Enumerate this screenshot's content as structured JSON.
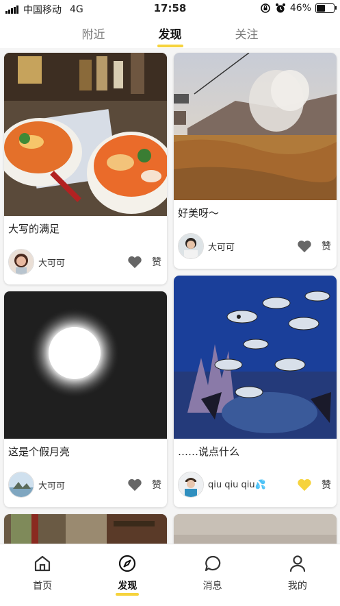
{
  "status_bar": {
    "carrier": "中国移动",
    "network": "4G",
    "time": "17:58",
    "battery": "46%",
    "battery_level": 0.46
  },
  "top_tabs": [
    {
      "label": "附近",
      "active": false
    },
    {
      "label": "发现",
      "active": true
    },
    {
      "label": "关注",
      "active": false
    }
  ],
  "accent_color": "#f6d33d",
  "feed": {
    "left": [
      {
        "title": "大写的满足",
        "author": "大可可",
        "like_label": "赞",
        "liked": false,
        "image": "ramen-photo"
      },
      {
        "title": "这是个假月亮",
        "author": "大可可",
        "like_label": "赞",
        "liked": false,
        "image": "moon-photo"
      },
      {
        "image": "street-photo"
      }
    ],
    "right": [
      {
        "title": "好美呀～",
        "author": "大可可",
        "like_label": "赞",
        "liked": false,
        "image": "volcano-photo"
      },
      {
        "title": "……说点什么",
        "author": "qiu qiu qiu💦",
        "like_label": "赞",
        "liked": true,
        "image": "aquarium-photo"
      },
      {
        "image": "ground-photo"
      }
    ]
  },
  "bottom_nav": [
    {
      "label": "首页",
      "icon": "home-icon",
      "active": false
    },
    {
      "label": "发现",
      "icon": "compass-icon",
      "active": true
    },
    {
      "label": "消息",
      "icon": "message-icon",
      "active": false
    },
    {
      "label": "我的",
      "icon": "profile-icon",
      "active": false
    }
  ]
}
